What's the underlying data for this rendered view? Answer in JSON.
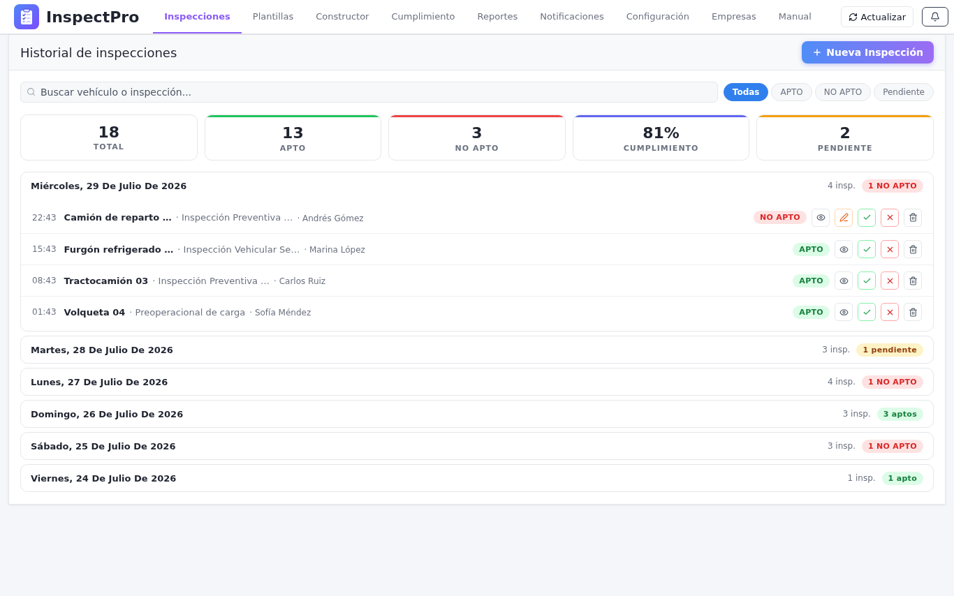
{
  "app": {
    "name": "InspectPro"
  },
  "nav": {
    "tabs": [
      {
        "label": "Inspecciones",
        "selected": true
      },
      {
        "label": "Plantillas",
        "selected": false
      },
      {
        "label": "Constructor",
        "selected": false
      },
      {
        "label": "Cumplimiento",
        "selected": false
      },
      {
        "label": "Reportes",
        "selected": false
      },
      {
        "label": "Notificaciones",
        "selected": false
      },
      {
        "label": "Configuración",
        "selected": false
      },
      {
        "label": "Empresas",
        "selected": false
      },
      {
        "label": "Manual",
        "selected": false
      }
    ]
  },
  "header_actions": {
    "refresh_label": "Actualizar"
  },
  "page": {
    "title": "Historial de inspecciones",
    "new_button": "Nueva Inspección"
  },
  "search": {
    "placeholder": "Buscar vehículo o inspección..."
  },
  "filters": [
    {
      "label": "Todas",
      "selected": true
    },
    {
      "label": "APTO",
      "selected": false
    },
    {
      "label": "NO APTO",
      "selected": false
    },
    {
      "label": "Pendiente",
      "selected": false
    }
  ],
  "stats": [
    {
      "value": "18",
      "label": "TOTAL"
    },
    {
      "value": "13",
      "label": "APTO",
      "color": "#22c55e"
    },
    {
      "value": "3",
      "label": "NO APTO",
      "color": "#ef4444"
    },
    {
      "value": "81%",
      "label": "CUMPLIMIENTO",
      "color": "#6366f1"
    },
    {
      "value": "2",
      "label": "PENDIENTE",
      "color": "#f59e0b"
    }
  ],
  "days": [
    {
      "title": "Miércoles, 29 De Julio De 2026",
      "count": "4 insp.",
      "badge": {
        "label": "1 NO APTO",
        "kind": "no_apto"
      },
      "expanded": true,
      "rows": [
        {
          "time": "22:43",
          "vehicle": "Camión de reparto …",
          "template": "· Inspección Preventiva …",
          "inspector": "· Andrés Gómez",
          "status": {
            "label": "NO APTO",
            "kind": "no_apto"
          },
          "actions": [
            {
              "kind": "view"
            },
            {
              "kind": "edit"
            },
            {
              "kind": "approve"
            },
            {
              "kind": "reject"
            },
            {
              "kind": "delete"
            }
          ]
        },
        {
          "time": "15:43",
          "vehicle": "Furgón refrigerado …",
          "template": "· Inspección Vehicular Se…",
          "inspector": "· Marina López",
          "status": {
            "label": "APTO",
            "kind": "apto"
          },
          "actions": [
            {
              "kind": "view"
            },
            {
              "kind": "approve"
            },
            {
              "kind": "reject"
            },
            {
              "kind": "delete"
            }
          ]
        },
        {
          "time": "08:43",
          "vehicle": "Tractocamión 03",
          "template": "· Inspección Preventiva …",
          "inspector": "· Carlos Ruiz",
          "status": {
            "label": "APTO",
            "kind": "apto"
          },
          "actions": [
            {
              "kind": "view"
            },
            {
              "kind": "approve"
            },
            {
              "kind": "reject"
            },
            {
              "kind": "delete"
            }
          ]
        },
        {
          "time": "01:43",
          "vehicle": "Volqueta 04",
          "template": "· Preoperacional de carga",
          "inspector": "· Sofía Méndez",
          "status": {
            "label": "APTO",
            "kind": "apto"
          },
          "actions": [
            {
              "kind": "view"
            },
            {
              "kind": "approve"
            },
            {
              "kind": "reject"
            },
            {
              "kind": "delete"
            }
          ]
        }
      ]
    },
    {
      "title": "Martes, 28 De Julio De 2026",
      "count": "3 insp.",
      "badge": {
        "label": "1 pendiente",
        "kind": "pending"
      },
      "expanded": false
    },
    {
      "title": "Lunes, 27 De Julio De 2026",
      "count": "4 insp.",
      "badge": {
        "label": "1 NO APTO",
        "kind": "no_apto"
      },
      "expanded": false
    },
    {
      "title": "Domingo, 26 De Julio De 2026",
      "count": "3 insp.",
      "badge": {
        "label": "3 aptos",
        "kind": "apto"
      },
      "expanded": false
    },
    {
      "title": "Sábado, 25 De Julio De 2026",
      "count": "3 insp.",
      "badge": {
        "label": "1 NO APTO",
        "kind": "no_apto"
      },
      "expanded": false
    },
    {
      "title": "Viernes, 24 De Julio De 2026",
      "count": "1 insp.",
      "badge": {
        "label": "1 apto",
        "kind": "apto"
      },
      "expanded": false
    }
  ]
}
